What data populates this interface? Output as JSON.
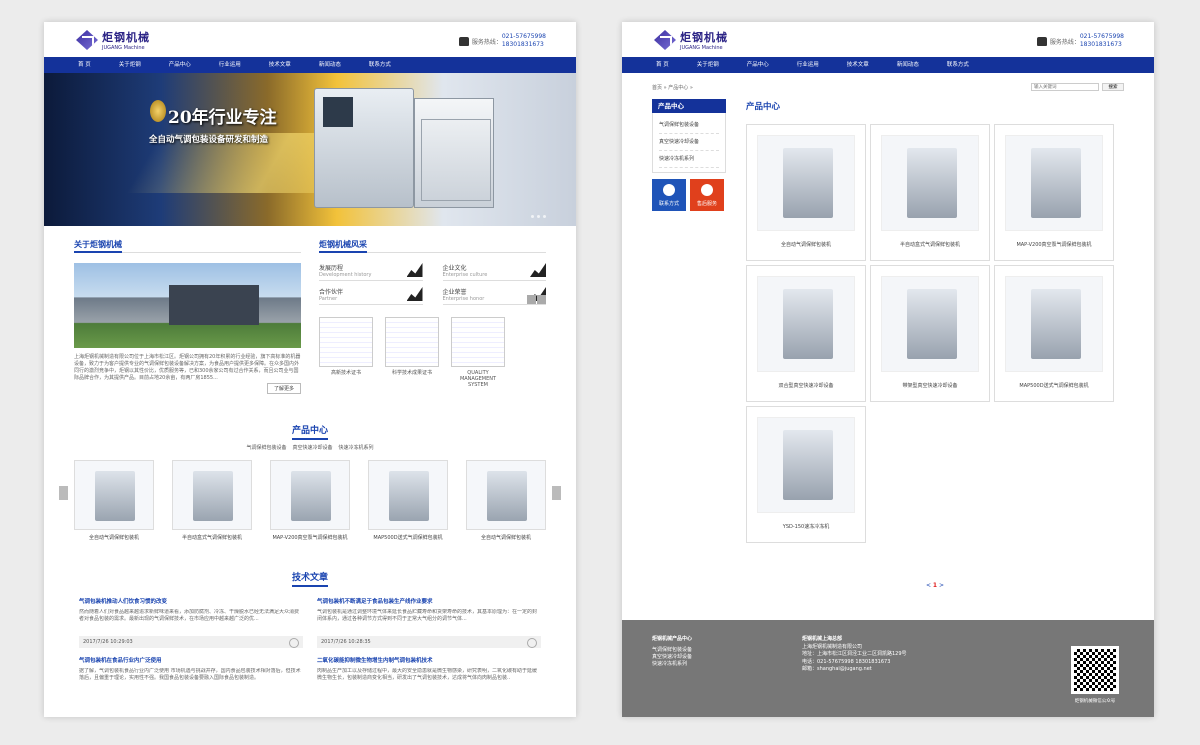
{
  "brand": {
    "name_cn": "炬钢机械",
    "name_en": "JUGANG Machine",
    "hotline_label": "服务热线：",
    "hotline_1": "021-57675998",
    "hotline_2": "18301831673"
  },
  "nav": [
    "首 页",
    "关于炬钢",
    "产品中心",
    "行业运用",
    "技术文章",
    "新闻动态",
    "联系方式"
  ],
  "banner": {
    "title": "20年行业专注",
    "subtitle": "全自动气调包装设备研发和制造"
  },
  "about": {
    "title": "关于炬钢机械",
    "text": "上海炬钢机械制造有限公司位于上海市松江区。炬钢公司拥有20年积累的行业经验，旗下高标准的机器设备，致力于为客户提供专业的气调保鲜包装设备解决方案，为食品用户提供更多保障。在众多国内外同行的激烈竞争中，炬钢以其性价比，优质服务等，已和300余家公司有过合作关系，而且公司业与国际品牌合作，为其提供产品。目前占地20余亩，有两厂房1855...",
    "more": "了解更多"
  },
  "style": {
    "title": "炬钢机械风采",
    "items": [
      {
        "cn": "发展历程",
        "en": "Development history"
      },
      {
        "cn": "企业文化",
        "en": "Enterprise culture"
      },
      {
        "cn": "合作伙伴",
        "en": "Partner"
      },
      {
        "cn": "企业荣誉",
        "en": "Enterprise honor"
      }
    ],
    "certs": [
      "高新技术证书",
      "科学技术成果证书",
      "QUALITY MANAGEMENT SYSTEM"
    ]
  },
  "products": {
    "title": "产品中心",
    "cats": [
      "气调保鲜包装设备",
      "真空快速冷却设备",
      "快速冷冻机系列"
    ],
    "items": [
      "全自动气调保鲜包装机",
      "半自动盒式气调保鲜包装机",
      "MAP-V200真空泵气调保鲜包装机",
      "MAP500D送式气调保鲜包装机",
      "全自动气调保鲜包装机"
    ]
  },
  "news": {
    "title": "技术文章",
    "items": [
      {
        "title": "气调包装机推动人们饮食习惯的改变",
        "body": "然而随着人们对食品越来越追求新鲜味道来看，添加防腐剂、冷冻、干燥脱水已经无法满足大众消费者对食品包装的需求。最新出现的气调保鲜技术，在市场应用中越来越广泛的优...",
        "date": "2017/7/26 10:29:03"
      },
      {
        "title": "气调包装机不断满足于食品包装生产线作业要求",
        "body": "气调包装机是通过调整环境气体来延长食品贮藏寿命和货架寿命的技术，其基本原理为：在一定的封闭体系内，通过各种调节方式得到不同于正常大气组分的调节气体...",
        "date": "2017/7/26 10:28:35"
      },
      {
        "title": "气调包装机在食品行业内广泛使用",
        "body": "据了解，气调包装机食品行业内广泛使用 市场机遇与挑战并存，国内食品包装技术相对落后，但技术落后，且偏重于理论，实用性不强。我国食品包装设备要融入国际食品包装制造。",
        "date": ""
      },
      {
        "title": "二氧化碳能抑制微生物增生内制气调包装机技术",
        "body": "肉制品生产加工以及存储过程中，最大的安全隐患就是微生物感染，研究表明，二氧化碳有助于延缓微生物生长，包装制造商变化相当，研发出了气调包装技术，达成将气体向肉制品包装..",
        "date": ""
      }
    ]
  },
  "p2": {
    "crumb": "首页 » 产品中心 »",
    "search_placeholder": "输入关键词",
    "search_btn": "搜索",
    "sidebar_title": "产品中心",
    "sidebar_items": [
      "气调保鲜包装设备",
      "真空快速冷却设备",
      "快速冷冻机系列"
    ],
    "btn_contact": "联系方式",
    "btn_service": "售后服务",
    "main_title": "产品中心",
    "grid": [
      "全自动气调保鲜包装机",
      "半自动盒式气调保鲜包装机",
      "MAP-V200真空泵气调保鲜包装机",
      "双合型真空快速冷却设备",
      "带架型真空快速冷却设备",
      "MAP500D送式气调保鲜包装机",
      "YSD-150速冻冷冻机"
    ],
    "pager_prev": "<",
    "pager_cur": "1",
    "pager_next": ">"
  },
  "footer": {
    "col1_title": "炬钢机械产品中心",
    "col1_items": [
      "气调保鲜包装设备",
      "真空快速冷却设备",
      "快速冷冻机系列"
    ],
    "col2_title": "炬钢机械上海总部",
    "company": "上海炬钢机械制造有限公司",
    "address": "地址：上海市松江区洞泾工业二区洞凯路129号",
    "phone": "电话：021-57675998 18301831673",
    "email": "邮箱：shanghai@jugang.net",
    "qr_caption": "炬钢机械微信公众号"
  }
}
